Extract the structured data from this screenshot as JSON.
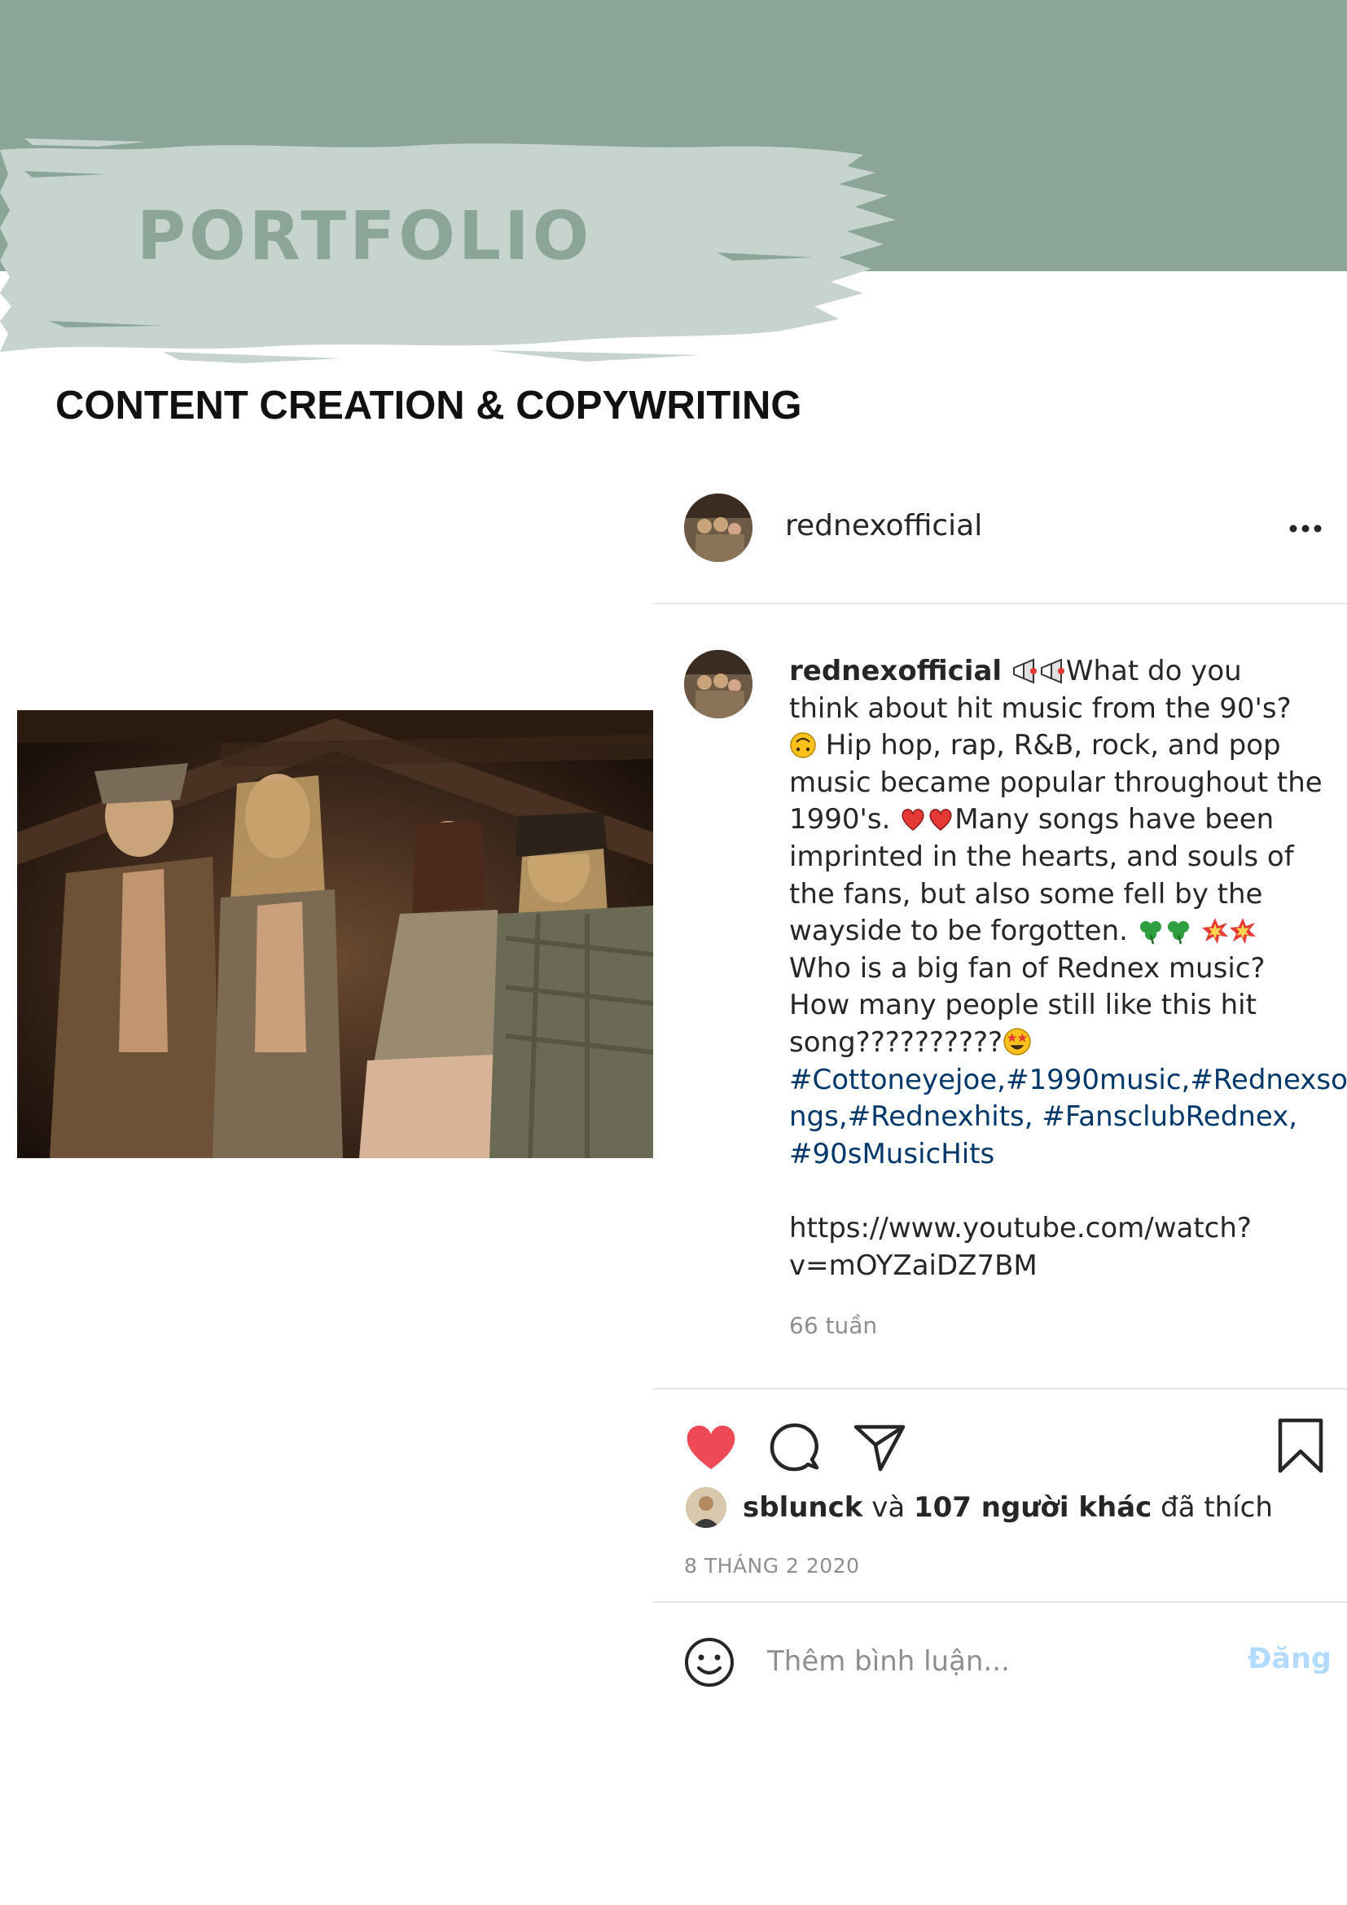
{
  "header": {
    "title": "PORTFOLIO",
    "subtitle": "CONTENT CREATION & COPYWRITING",
    "band_color": "#8ba598",
    "brush_color": "#c7d4ce"
  },
  "post": {
    "username": "rednexofficial",
    "more_icon": "more-horizontal-icon",
    "caption": {
      "username": "rednexofficial",
      "lines": [
        {
          "emoji_before": [
            "megaphone",
            "megaphone"
          ],
          "text": "What do you"
        },
        {
          "text": "think about hit music from the 90's?"
        },
        {
          "emoji_before": [
            "upside-down-face"
          ],
          "text": " Hip hop, rap, R&B, rock, and pop"
        },
        {
          "text": "music became popular throughout the"
        },
        {
          "text": "1990's. ",
          "emoji_after": [
            "red-heart",
            "red-heart"
          ],
          "text_after": "Many songs have been"
        },
        {
          "text": "imprinted in the hearts, and souls of"
        },
        {
          "text": "the fans, but also some fell by the"
        },
        {
          "text": "wayside to be forgotten. ",
          "emoji_after": [
            "shamrock",
            "shamrock",
            "collision",
            "collision"
          ]
        },
        {
          "text": "Who is a big fan of Rednex music?"
        },
        {
          "text": "How many people still like this hit"
        },
        {
          "text": "song??????????",
          "emoji_after": [
            "star-struck"
          ]
        }
      ],
      "hashtags": [
        "#Cottoneyejoe,#1990music,#Rednexso",
        "ngs,#Rednexhits, #FansclubRednex,",
        "#90sMusicHits"
      ],
      "link_lines": [
        "https://www.youtube.com/watch?",
        "v=mOYZaiDZ7BM"
      ]
    },
    "time_ago": "66 tuần",
    "actions": {
      "like_icon": "heart-filled-icon",
      "comment_icon": "comment-icon",
      "share_icon": "paper-plane-icon",
      "save_icon": "bookmark-icon",
      "like_color": "#ed4956"
    },
    "likes": {
      "user": "sblunck",
      "connector": " và ",
      "others": "107 người khác",
      "suffix": " đã thích"
    },
    "date": "8 THÁNG 2 2020",
    "comment_box": {
      "emoji_icon": "smiley-icon",
      "placeholder": "Thêm bình luận...",
      "post_label": "Đăng"
    }
  }
}
